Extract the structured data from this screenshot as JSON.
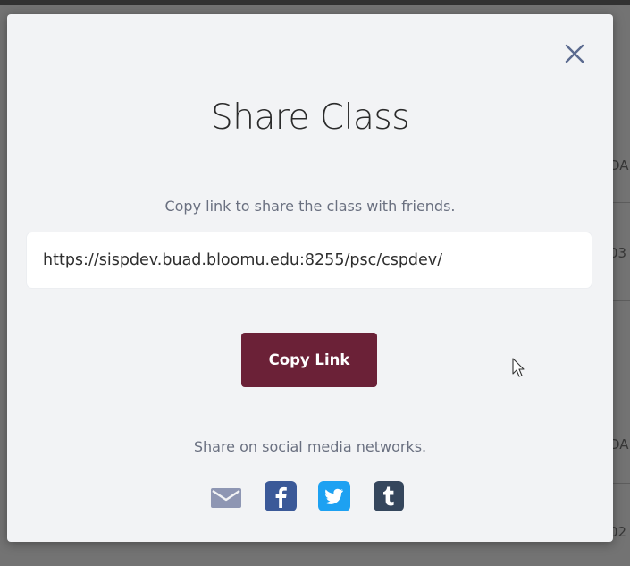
{
  "modal": {
    "title": "Share Class",
    "subtitle": "Copy link to share the class with friends.",
    "link_value": "https://sispdev.buad.bloomu.edu:8255/psc/cspdev/",
    "copy_button_label": "Copy Link",
    "social_label": "Share on social media networks.",
    "close_icon": "close-icon",
    "social_icons": [
      "email-icon",
      "facebook-icon",
      "twitter-icon",
      "tumblr-icon"
    ]
  },
  "background": {
    "cells": [
      "DA",
      "03",
      "DA",
      "02"
    ]
  },
  "colors": {
    "primary_button": "#6b2137",
    "close_icon": "#5b6a8f",
    "facebook": "#3b5998",
    "twitter": "#1da1f2",
    "tumblr": "#35465c",
    "email": "#8e96b3"
  }
}
